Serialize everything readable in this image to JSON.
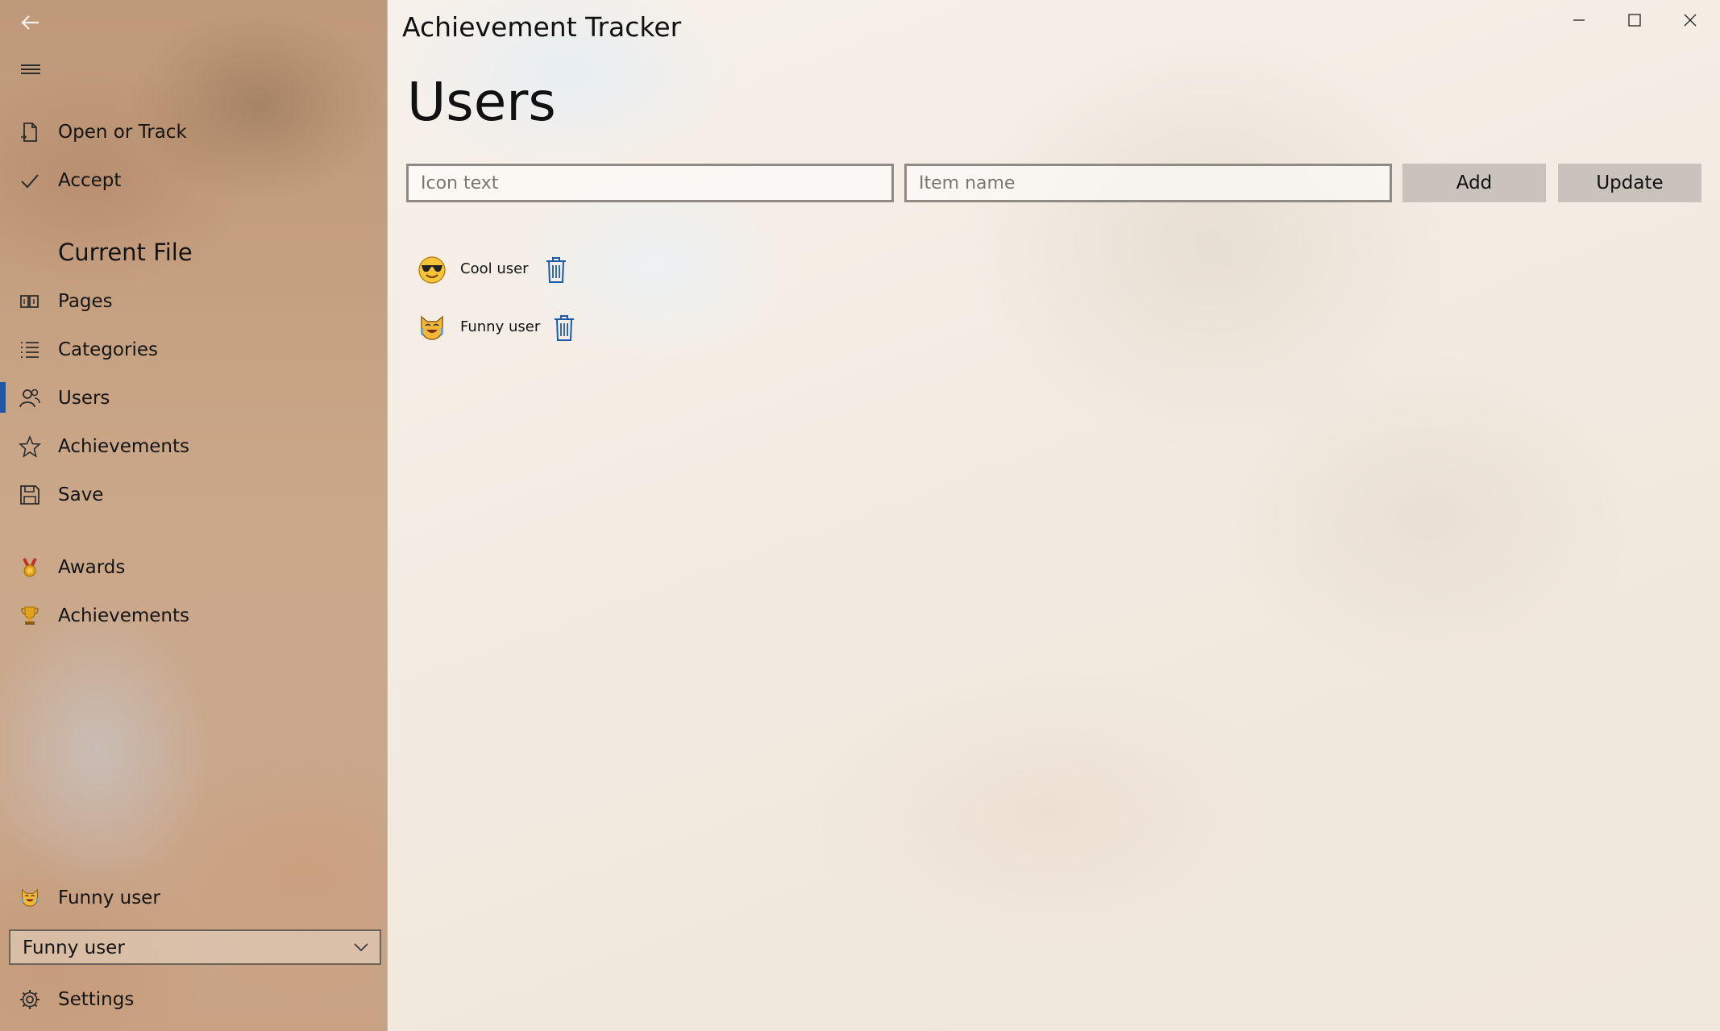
{
  "window": {
    "title": "Achievement Tracker"
  },
  "nav": {
    "top_items": [
      {
        "icon": "open-document-icon",
        "label": "Open or Track"
      },
      {
        "icon": "checkmark-icon",
        "label": "Accept"
      }
    ],
    "section_header": "Current File",
    "file_items": [
      {
        "icon": "pages-icon",
        "label": "Pages"
      },
      {
        "icon": "list-icon",
        "label": "Categories"
      },
      {
        "icon": "people-icon",
        "label": "Users",
        "selected": true
      },
      {
        "icon": "star-icon",
        "label": "Achievements"
      },
      {
        "icon": "save-icon",
        "label": "Save"
      }
    ],
    "extra_items": [
      {
        "icon": "medal-icon",
        "label": "Awards"
      },
      {
        "icon": "trophy-icon",
        "label": "Achievements"
      }
    ],
    "current_user": {
      "icon": "cat-joy-icon",
      "label": "Funny user"
    },
    "user_select": {
      "selected": "Funny user"
    },
    "settings": {
      "icon": "gear-icon",
      "label": "Settings"
    },
    "accent_color": "#1c5aa8"
  },
  "page": {
    "title": "Users",
    "icon_text_input": {
      "placeholder": "Icon text",
      "value": ""
    },
    "item_name_input": {
      "placeholder": "Item name",
      "value": ""
    },
    "add_label": "Add",
    "update_label": "Update",
    "users": [
      {
        "icon": "smiling-face-with-sunglasses-icon",
        "name": "Cool user"
      },
      {
        "icon": "cat-joy-icon",
        "name": "Funny user"
      }
    ]
  }
}
